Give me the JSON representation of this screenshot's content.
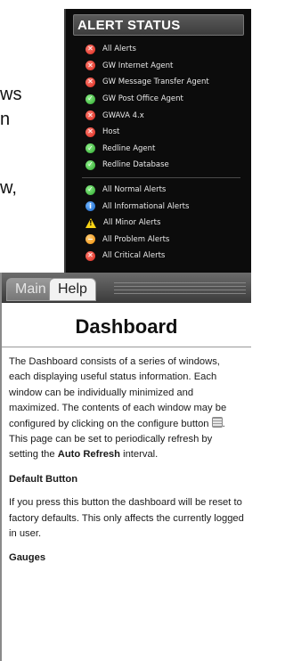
{
  "background_text": {
    "frag1": "ws",
    "frag2": "n",
    "frag3": "w,"
  },
  "alert_status": {
    "title": "ALERT STATUS",
    "items": [
      {
        "label": "All Alerts",
        "icon": "error-icon",
        "color": "#d8281c"
      },
      {
        "label": "GW Internet Agent",
        "icon": "error-icon",
        "color": "#d8281c"
      },
      {
        "label": "GW Message Transfer Agent",
        "icon": "error-icon",
        "color": "#d8281c"
      },
      {
        "label": "GW Post Office Agent",
        "icon": "ok-icon",
        "color": "#2aa52a"
      },
      {
        "label": "GWAVA 4.x",
        "icon": "error-icon",
        "color": "#d8281c"
      },
      {
        "label": "Host",
        "icon": "error-icon",
        "color": "#d8281c"
      },
      {
        "label": "Redline Agent",
        "icon": "ok-icon",
        "color": "#2aa52a"
      },
      {
        "label": "Redline Database",
        "icon": "ok-icon",
        "color": "#2aa52a"
      }
    ],
    "summary_items": [
      {
        "label": "All Normal Alerts",
        "icon": "ok-icon",
        "color": "#2aa52a"
      },
      {
        "label": "All Informational Alerts",
        "icon": "info-icon",
        "color": "#1764c6"
      },
      {
        "label": "All Minor Alerts",
        "icon": "warning-icon",
        "color": "#f7d216"
      },
      {
        "label": "All Problem Alerts",
        "icon": "minus-icon",
        "color": "#f08a00"
      },
      {
        "label": "All Critical Alerts",
        "icon": "error-icon",
        "color": "#d8281c"
      }
    ]
  },
  "help_window": {
    "tabs": [
      {
        "label": "Main",
        "active": false
      },
      {
        "label": "Help",
        "active": true
      }
    ],
    "title": "Dashboard",
    "intro_before_icon": "The Dashboard consists of a series of windows, each displaying useful status information. Each window can be individually minimized and maximized. The contents of each window may be configured by clicking on the configure button",
    "intro_icon": "configure-icon",
    "intro_after_icon": ". This page can be set to periodically refresh by setting the ",
    "intro_bold": "Auto Refresh",
    "intro_end": " interval.",
    "section1_heading": "Default Button",
    "section1_text": "If you press this button the dashboard will be reset to factory defaults. This only affects the currently logged in user.",
    "section2_heading": "Gauges"
  }
}
